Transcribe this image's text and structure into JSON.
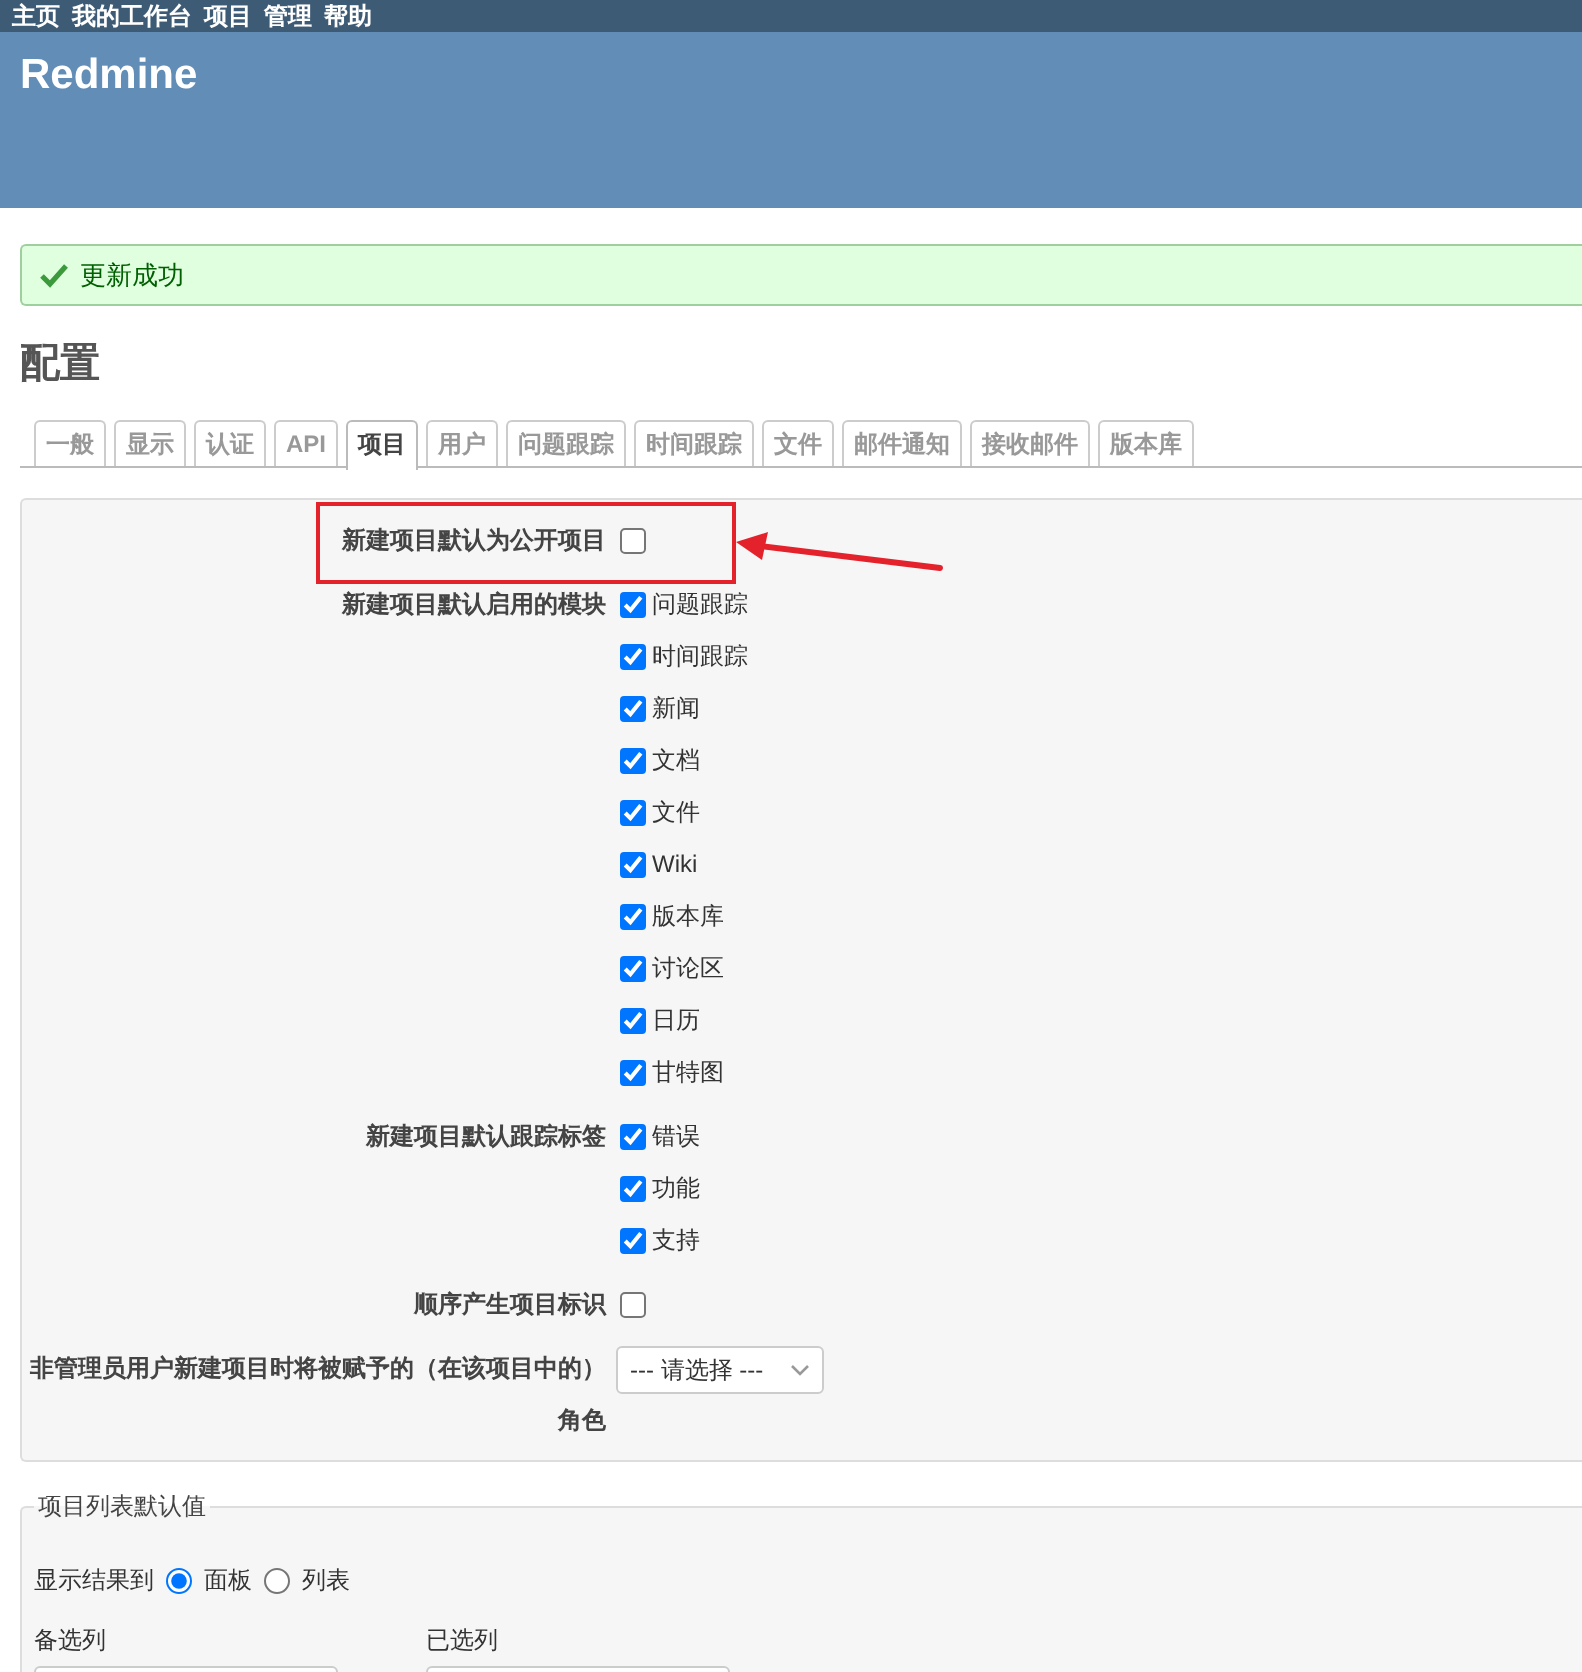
{
  "top_menu": [
    "主页",
    "我的工作台",
    "项目",
    "管理",
    "帮助"
  ],
  "header": {
    "title": "Redmine"
  },
  "flash": {
    "text": "更新成功"
  },
  "page_title": "配置",
  "tabs": [
    {
      "label": "一般",
      "selected": false
    },
    {
      "label": "显示",
      "selected": false
    },
    {
      "label": "认证",
      "selected": false
    },
    {
      "label": "API",
      "selected": false
    },
    {
      "label": "项目",
      "selected": true
    },
    {
      "label": "用户",
      "selected": false
    },
    {
      "label": "问题跟踪",
      "selected": false
    },
    {
      "label": "时间跟踪",
      "selected": false
    },
    {
      "label": "文件",
      "selected": false
    },
    {
      "label": "邮件通知",
      "selected": false
    },
    {
      "label": "接收邮件",
      "selected": false
    },
    {
      "label": "版本库",
      "selected": false
    }
  ],
  "project_settings": [
    {
      "kind": "checkbox",
      "label": "新建项目默认为公开项目",
      "checked": false,
      "highlighted": true
    },
    {
      "kind": "checklist",
      "label": "新建项目默认启用的模块",
      "options": [
        {
          "label": "问题跟踪",
          "checked": true
        },
        {
          "label": "时间跟踪",
          "checked": true
        },
        {
          "label": "新闻",
          "checked": true
        },
        {
          "label": "文档",
          "checked": true
        },
        {
          "label": "文件",
          "checked": true
        },
        {
          "label": "Wiki",
          "checked": true
        },
        {
          "label": "版本库",
          "checked": true
        },
        {
          "label": "讨论区",
          "checked": true
        },
        {
          "label": "日历",
          "checked": true
        },
        {
          "label": "甘特图",
          "checked": true
        }
      ]
    },
    {
      "kind": "checklist",
      "label": "新建项目默认跟踪标签",
      "options": [
        {
          "label": "错误",
          "checked": true
        },
        {
          "label": "功能",
          "checked": true
        },
        {
          "label": "支持",
          "checked": true
        }
      ]
    },
    {
      "kind": "checkbox",
      "label": "顺序产生项目标识",
      "checked": false
    },
    {
      "kind": "select",
      "label": "非管理员用户新建项目时将被赋予的（在该项目中的）角色",
      "value": "--- 请选择 ---"
    }
  ],
  "project_list_defaults": {
    "legend": "项目列表默认值",
    "display_label": "显示结果到",
    "display_options": [
      {
        "label": "面板",
        "selected": true
      },
      {
        "label": "列表",
        "selected": false
      }
    ],
    "available_label": "备选列",
    "selected_label": "已选列"
  }
}
